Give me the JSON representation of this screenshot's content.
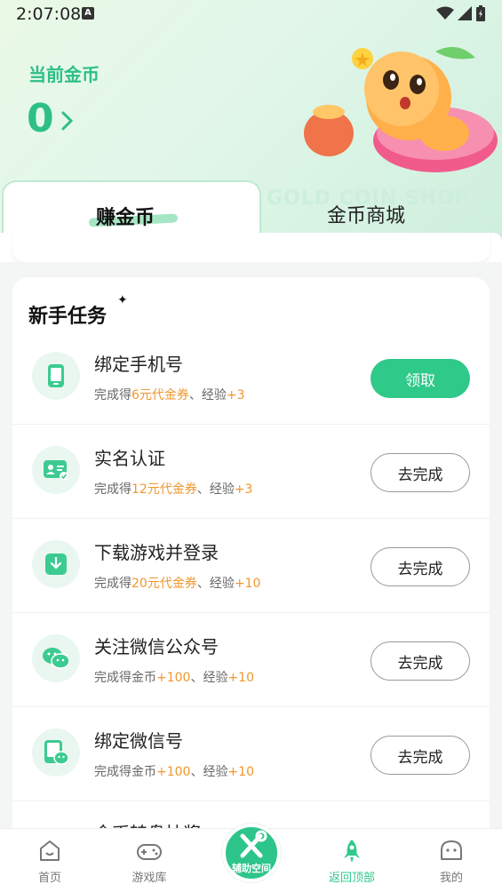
{
  "status_bar": {
    "time": "2:07:08",
    "badge": "A"
  },
  "header": {
    "coin_label": "当前金币",
    "coin_value": "0"
  },
  "tabs": {
    "earn": "赚金币",
    "shop": "金币商城",
    "shop_bg_text": "GOLD COIN SHOP"
  },
  "card": {
    "title": "新手任务",
    "tasks": [
      {
        "name": "绑定手机号",
        "desc_prefix": "完成得",
        "reward": "6元代金券",
        "sep": "、经验",
        "exp": "+3",
        "button": "领取",
        "icon": "phone-icon"
      },
      {
        "name": "实名认证",
        "desc_prefix": "完成得",
        "reward": "12元代金券",
        "sep": "、经验",
        "exp": "+3",
        "button": "去完成",
        "icon": "id-card-icon"
      },
      {
        "name": "下载游戏并登录",
        "desc_prefix": "完成得",
        "reward": "20元代金券",
        "sep": "、经验",
        "exp": "+10",
        "button": "去完成",
        "icon": "download-icon"
      },
      {
        "name": "关注微信公众号",
        "desc_prefix": "完成得金币",
        "reward": "+100",
        "sep": "、经验",
        "exp": "+10",
        "button": "去完成",
        "icon": "wechat-icon"
      },
      {
        "name": "绑定微信号",
        "desc_prefix": "完成得金币",
        "reward": "+100",
        "sep": "、经验",
        "exp": "+10",
        "button": "去完成",
        "icon": "wechat-bind-icon"
      }
    ],
    "partial_task_name": "金币转盘抽奖"
  },
  "bottom_nav": {
    "home": "首页",
    "games": "游戏库",
    "center": "辅助空间",
    "top": "返回顶部",
    "me": "我的"
  },
  "colors": {
    "accent": "#2fc98a",
    "orange": "#f0972d"
  }
}
